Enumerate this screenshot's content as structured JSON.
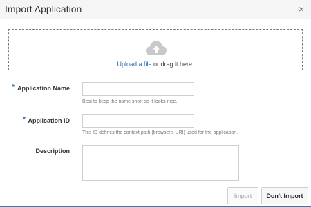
{
  "dialog": {
    "title": "Import Application",
    "close_symbol": "×",
    "close_icon": "close-icon"
  },
  "dropzone": {
    "icon": "cloud-upload-icon",
    "link_text": "Upload a file",
    "rest_text": " or drag it here."
  },
  "form": {
    "name": {
      "required_mark": "*",
      "label": "Application Name",
      "value": "",
      "hint": "Best to keep the name short so it looks nice."
    },
    "id": {
      "required_mark": "*",
      "label": "Application ID",
      "value": "",
      "hint": "This ID defines the context path (browser's URI) used for the application."
    },
    "description": {
      "label": "Description",
      "value": ""
    }
  },
  "footer": {
    "import_label": "Import",
    "dont_import_label": "Don't Import"
  },
  "colors": {
    "accent": "#2566a8",
    "bottom_bar": "#2e7bb8",
    "cloud_icon": "#c9c9c9"
  }
}
